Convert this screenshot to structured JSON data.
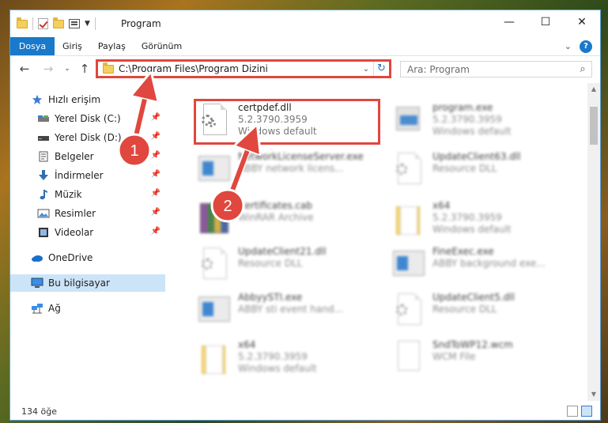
{
  "window": {
    "title": "Program",
    "controls": {
      "minimize": "—",
      "maximize": "☐",
      "close": "✕"
    }
  },
  "ribbon": {
    "tabs": [
      "Dosya",
      "Giriş",
      "Paylaş",
      "Görünüm"
    ]
  },
  "address": {
    "path": "C:\\Program Files\\Program Dizini",
    "search_placeholder": "Ara: Program"
  },
  "nav": {
    "items": [
      {
        "label": "Hızlı erişim",
        "icon": "star-icon",
        "pinned": false
      },
      {
        "label": "Yerel Disk (C:)",
        "icon": "drive-icon",
        "pinned": true
      },
      {
        "label": "Yerel Disk (D:)",
        "icon": "drive-icon",
        "pinned": true
      },
      {
        "label": "Belgeler",
        "icon": "documents-icon",
        "pinned": true
      },
      {
        "label": "İndirmeler",
        "icon": "download-icon",
        "pinned": true
      },
      {
        "label": "Müzik",
        "icon": "music-icon",
        "pinned": true
      },
      {
        "label": "Resimler",
        "icon": "pictures-icon",
        "pinned": true
      },
      {
        "label": "Videolar",
        "icon": "videos-icon",
        "pinned": true
      },
      {
        "label": "OneDrive",
        "icon": "cloud-icon",
        "pinned": false
      },
      {
        "label": "Bu bilgisayar",
        "icon": "computer-icon",
        "pinned": false,
        "selected": true
      },
      {
        "label": "Ağ",
        "icon": "network-icon",
        "pinned": false
      }
    ]
  },
  "files": [
    {
      "name": "certpdef.dll",
      "line2": "5.2.3790.3959",
      "line3": "Windows default",
      "icon": "dll-gear-icon",
      "highlighted": true,
      "blurred": false
    },
    {
      "name": "program.exe",
      "line2": "5.2.3790.3959",
      "line3": "Windows default",
      "icon": "installer-icon",
      "highlighted": false,
      "blurred": true
    },
    {
      "name": "NetworkLicenseServer.exe",
      "line2": "ABBY network licens...",
      "line3": "",
      "icon": "app-icon",
      "highlighted": false,
      "blurred": true
    },
    {
      "name": "UpdateClient63.dll",
      "line2": "Resource DLL",
      "line3": "",
      "icon": "dll-gear-icon",
      "highlighted": false,
      "blurred": true
    },
    {
      "name": "Certificates.cab",
      "line2": "WinRAR Archive",
      "line3": "",
      "icon": "winrar-icon",
      "highlighted": false,
      "blurred": true
    },
    {
      "name": "x64",
      "line2": "5.2.3790.3959",
      "line3": "Windows default",
      "icon": "folder-icon",
      "highlighted": false,
      "blurred": true
    },
    {
      "name": "UpdateClient21.dll",
      "line2": "Resource DLL",
      "line3": "",
      "icon": "dll-gear-icon",
      "highlighted": false,
      "blurred": true
    },
    {
      "name": "FineExec.exe",
      "line2": "ABBY background exe...",
      "line3": "",
      "icon": "app-icon",
      "highlighted": false,
      "blurred": true
    },
    {
      "name": "AbbyySTI.exe",
      "line2": "ABBY sti event hand...",
      "line3": "",
      "icon": "app-icon",
      "highlighted": false,
      "blurred": true
    },
    {
      "name": "UpdateClient5.dll",
      "line2": "Resource DLL",
      "line3": "",
      "icon": "dll-gear-icon",
      "highlighted": false,
      "blurred": true
    },
    {
      "name": "x64",
      "line2": "5.2.3790.3959",
      "line3": "Windows default",
      "icon": "folder-icon",
      "highlighted": false,
      "blurred": true
    },
    {
      "name": "SndToWP12.wcm",
      "line2": "WCM File",
      "line3": "",
      "icon": "blank-file-icon",
      "highlighted": false,
      "blurred": true
    }
  ],
  "status": {
    "count": "134 öğe"
  },
  "annotations": [
    {
      "label": "1"
    },
    {
      "label": "2"
    }
  ],
  "colors": {
    "accent": "#1979ca",
    "highlight": "#e0473e",
    "selected_bg": "#cce4f7"
  }
}
